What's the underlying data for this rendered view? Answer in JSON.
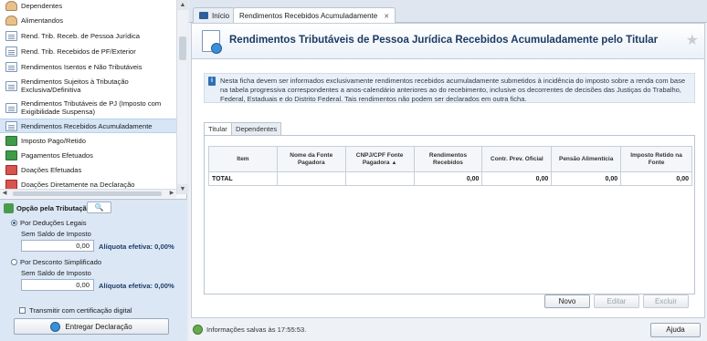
{
  "nav": {
    "items": [
      {
        "label": "Dependentes",
        "icon": "people-icon"
      },
      {
        "label": "Alimentandos",
        "icon": "people-icon"
      },
      {
        "label": "Rend. Trib. Receb. de Pessoa Jurídica",
        "icon": "document-icon"
      },
      {
        "label": "Rend. Trib. Recebidos de PF/Exterior",
        "icon": "document-icon"
      },
      {
        "label": "Rendimentos Isentos e Não Tributáveis",
        "icon": "document-icon"
      },
      {
        "label": "Rendimentos Sujeitos à Tributação Exclusiva/Definitiva",
        "icon": "document-icon"
      },
      {
        "label": "Rendimentos Tributáveis de PJ (Imposto com Exigibilidade Suspensa)",
        "icon": "document-icon"
      },
      {
        "label": "Rendimentos Recebidos Acumuladamente",
        "icon": "document-icon"
      },
      {
        "label": "Imposto Pago/Retido",
        "icon": "money-icon"
      },
      {
        "label": "Pagamentos Efetuados",
        "icon": "money-icon"
      },
      {
        "label": "Doações Efetuadas",
        "icon": "gift-icon"
      },
      {
        "label": "Doações Diretamente na Declaração",
        "icon": "gift-icon"
      }
    ]
  },
  "tributacao": {
    "title": "Opção pela Tributação:",
    "search_glyph": "🔍",
    "legais": {
      "label": "Por Deduções Legais",
      "saldo_label": "Sem Saldo de Imposto",
      "value": "0,00",
      "aliquota": "Alíquota efetiva: 0,00%"
    },
    "simplificado": {
      "label": "Por Desconto Simplificado",
      "saldo_label": "Sem Saldo de Imposto",
      "value": "0,00",
      "aliquota": "Alíquota efetiva: 0,00%"
    },
    "certificado_label": "Transmitir com certificação digital",
    "entregar_label": "Entregar Declaração"
  },
  "tabs": {
    "home": "Início",
    "current": "Rendimentos Recebidos Acumuladamente",
    "close_glyph": "✕"
  },
  "page": {
    "title": "Rendimentos Tributáveis de Pessoa Jurídica Recebidos Acumuladamente pelo Titular",
    "star_glyph": "★",
    "info": "Nesta ficha devem ser informados exclusivamente rendimentos recebidos acumuladamente submetidos à incidência do imposto sobre a renda com base na tabela progressiva correspondentes a anos-calendário anteriores ao do recebimento, inclusive os decorrentes de decisões das Justiças do Trabalho, Federal, Estaduais e do Distrito Federal. Tais rendimentos não podem ser declarados em outra ficha."
  },
  "subtabs": [
    "Titular",
    "Dependentes"
  ],
  "table": {
    "headers": [
      "Item",
      "Nome da Fonte Pagadora",
      "CNPJ/CPF Fonte Pagadora",
      "Rendimentos Recebidos",
      "Contr. Prev. Oficial",
      "Pensão Alimentícia",
      "Imposto Retido na Fonte"
    ],
    "sort_glyph": "▲",
    "total_row": [
      "TOTAL",
      "",
      "",
      "0,00",
      "0,00",
      "0,00",
      "0,00"
    ]
  },
  "buttons": {
    "novo": "Novo",
    "editar": "Editar",
    "excluir": "Excluir",
    "ajuda": "Ajuda"
  },
  "status": {
    "text": "Informações salvas às 17:55:53."
  }
}
